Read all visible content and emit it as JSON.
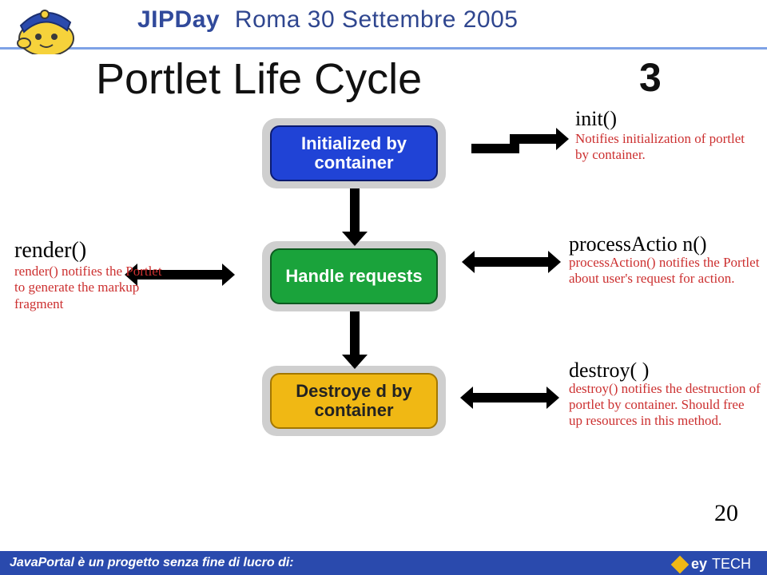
{
  "header": {
    "event": "JIPDay",
    "subtitle": "Roma 30 Settembre 2005"
  },
  "slide": {
    "title": "Portlet Life Cycle",
    "sequence": "3",
    "page_number": "20"
  },
  "states": {
    "initialized": "Initialized by container",
    "handle": "Handle requests",
    "destroyed": "Destroye d by container"
  },
  "labels": {
    "init": {
      "title": "init()",
      "desc": "Notifies initialization of portlet by container."
    },
    "render": {
      "title": "render()",
      "desc": "render() notifies the Portlet to generate the markup fragment"
    },
    "process": {
      "title": "processActio n()",
      "desc": "processAction() notifies the Portlet about user's request for action."
    },
    "destroy": {
      "title": "destroy( )",
      "desc": "destroy() notifies the destruction of portlet by container. Should free up resources in this method."
    }
  },
  "footer": {
    "text": "JavaPortal è un progetto senza fine di lucro di:",
    "brand_prefix": "ey",
    "brand_suffix": "TECH"
  }
}
